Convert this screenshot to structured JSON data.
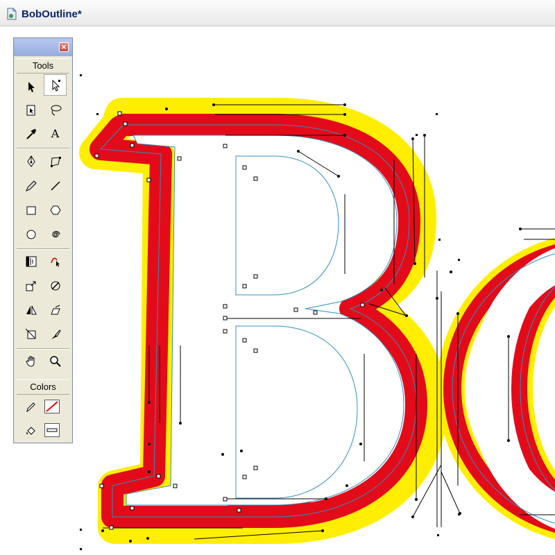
{
  "window": {
    "title": "BobOutline*"
  },
  "palette": {
    "tools_label": "Tools",
    "colors_label": "Colors",
    "close_glyph": "×",
    "text_tool_glyph": "A"
  },
  "artwork": {
    "letters": [
      "B",
      "o"
    ],
    "outer_stroke_color": "#ffee00",
    "inner_stroke_color": "#e30b1a",
    "fill_color": "#ffffff"
  }
}
